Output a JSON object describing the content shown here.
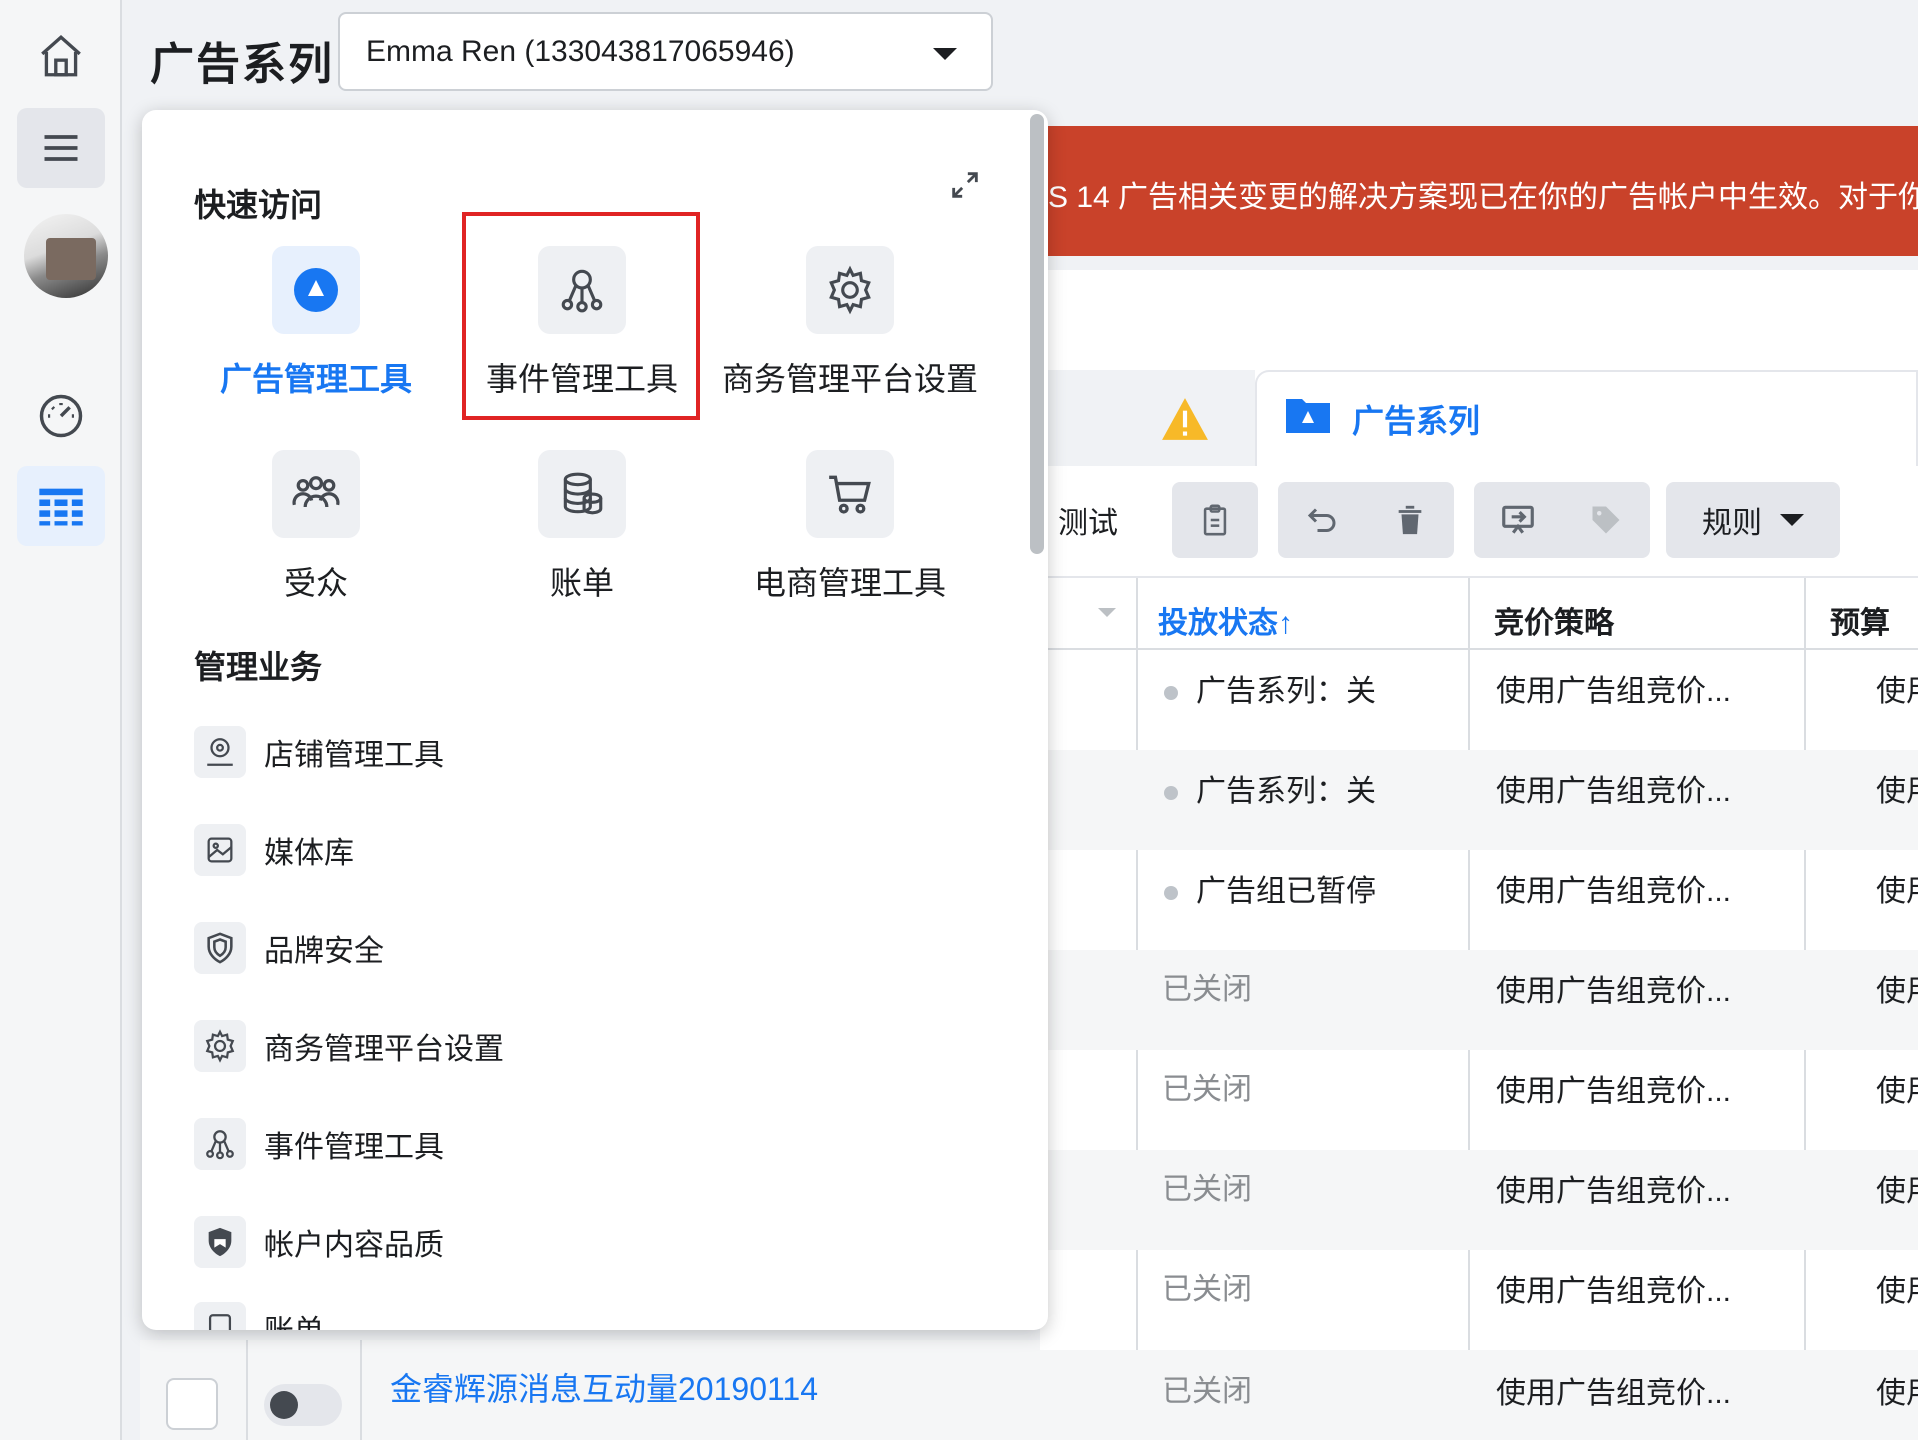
{
  "header": {
    "title": "广告系列",
    "account": "Emma Ren (133043817065946)"
  },
  "rail": {
    "items": [
      {
        "icon": "home-icon"
      },
      {
        "icon": "menu-icon"
      },
      {
        "icon": "avatar"
      },
      {
        "icon": "dashboard-icon"
      },
      {
        "icon": "table-icon"
      }
    ]
  },
  "banner": {
    "text": "S 14 广告相关变更的解决方案现已在你的广告帐户中生效。对于你"
  },
  "tabs": {
    "active_label": "广告系列"
  },
  "toolbar": {
    "test_label": "测试",
    "rules_label": "规则"
  },
  "table": {
    "headers": [
      "投放状态↑",
      "竞价策略",
      "预算"
    ],
    "rows": [
      {
        "status": "广告系列：关",
        "status_type": "dot",
        "bid": "使用广告组竞价...",
        "budget": "使用"
      },
      {
        "status": "广告系列：关",
        "status_type": "dot",
        "bid": "使用广告组竞价...",
        "budget": "使用"
      },
      {
        "status": "广告组已暂停",
        "status_type": "dot",
        "bid": "使用广告组竞价...",
        "budget": "使用"
      },
      {
        "status": "已关闭",
        "status_type": "plain",
        "bid": "使用广告组竞价...",
        "budget": "使用"
      },
      {
        "status": "已关闭",
        "status_type": "plain",
        "bid": "使用广告组竞价...",
        "budget": "使用"
      },
      {
        "status": "已关闭",
        "status_type": "plain",
        "bid": "使用广告组竞价...",
        "budget": "使用"
      },
      {
        "status": "已关闭",
        "status_type": "plain",
        "bid": "使用广告组竞价...",
        "budget": "使用"
      },
      {
        "status": "已关闭",
        "status_type": "plain",
        "bid": "使用广告组竞价...",
        "budget": "使用"
      }
    ],
    "visible_campaign_name": "金睿辉源消息互动量20190114"
  },
  "popup": {
    "quick_access_title": "快速访问",
    "quick_access": [
      {
        "label": "广告管理工具",
        "icon": "ads-manager-icon",
        "active": true
      },
      {
        "label": "事件管理工具",
        "icon": "events-manager-icon",
        "active": false,
        "highlighted": true
      },
      {
        "label": "商务管理平台设置",
        "icon": "gear-icon",
        "active": false
      },
      {
        "label": "受众",
        "icon": "audience-icon",
        "active": false
      },
      {
        "label": "账单",
        "icon": "billing-icon",
        "active": false
      },
      {
        "label": "电商管理工具",
        "icon": "cart-icon",
        "active": false
      }
    ],
    "manage_title": "管理业务",
    "manage_items": [
      {
        "label": "店铺管理工具",
        "icon": "store-location-icon"
      },
      {
        "label": "媒体库",
        "icon": "media-library-icon"
      },
      {
        "label": "品牌安全",
        "icon": "shield-icon"
      },
      {
        "label": "商务管理平台设置",
        "icon": "gear-icon"
      },
      {
        "label": "事件管理工具",
        "icon": "events-manager-icon"
      },
      {
        "label": "帐户内容品质",
        "icon": "account-quality-icon"
      },
      {
        "label": "账单",
        "icon": "billing-icon"
      }
    ]
  },
  "colors": {
    "accent": "#1877f2",
    "banner": "#c9422a",
    "highlight": "#e02424"
  }
}
